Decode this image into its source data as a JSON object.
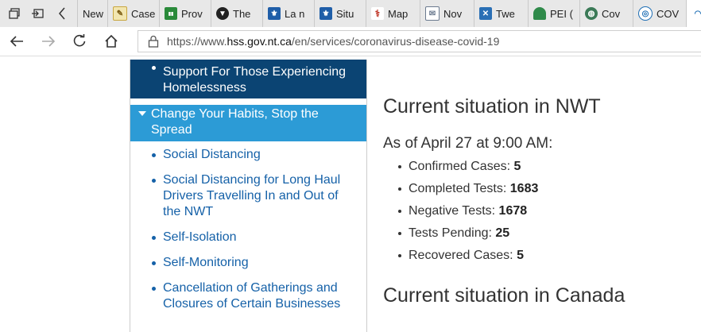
{
  "browser": {
    "tabs": [
      {
        "title": "New",
        "icon": "new-tab-icon",
        "color": "#e8e8e8"
      },
      {
        "title": "Case",
        "icon": "document-icon",
        "color": "#e3c25a"
      },
      {
        "title": "Prov",
        "icon": "stats-icon",
        "color": "#2a8a3a"
      },
      {
        "title": "The",
        "icon": "shield-icon",
        "color": "#222222"
      },
      {
        "title": "La n",
        "icon": "fleur-de-lis-icon",
        "color": "#1f5ea8"
      },
      {
        "title": "Situ",
        "icon": "fleur-de-lis-icon",
        "color": "#1f5ea8"
      },
      {
        "title": "Map",
        "icon": "map-icon",
        "color": "#c0392b"
      },
      {
        "title": "Nov",
        "icon": "envelope-icon",
        "color": "#6b7a8f"
      },
      {
        "title": "Twe",
        "icon": "flag-icon",
        "color": "#2a6fb5"
      },
      {
        "title": "PEI (",
        "icon": "island-icon",
        "color": "#2f8a4a"
      },
      {
        "title": "Cov",
        "icon": "globe-icon",
        "color": "#3b7a57"
      },
      {
        "title": "COV",
        "icon": "ribbon-icon",
        "color": "#1f6fb5"
      }
    ],
    "url_prefix": "https://www.",
    "url_domain": "hss.gov.nt.ca",
    "url_path": "/en/services/coronavirus-disease-covid-19"
  },
  "sidebar": {
    "items": [
      {
        "label": "Support For Those Experiencing Homelessness"
      },
      {
        "label": "Change Your Habits, Stop the Spread"
      },
      {
        "label": "Social Distancing"
      },
      {
        "label": "Social Distancing for Long Haul Drivers Travelling In and Out of the NWT"
      },
      {
        "label": "Self-Isolation"
      },
      {
        "label": "Self-Monitoring"
      },
      {
        "label": "Cancellation of Gatherings and Closures of Certain Businesses"
      }
    ]
  },
  "main": {
    "heading_nwt": "Current situation in NWT",
    "as_of": "As of April 27 at 9:00 AM:",
    "stats": [
      {
        "label": "Confirmed Cases:",
        "value": "5"
      },
      {
        "label": "Completed Tests:",
        "value": "1683"
      },
      {
        "label": "Negative Tests:",
        "value": "1678"
      },
      {
        "label": "Tests Pending:",
        "value": "25"
      },
      {
        "label": "Recovered Cases:",
        "value": "5"
      }
    ],
    "heading_canada": "Current situation in Canada"
  }
}
